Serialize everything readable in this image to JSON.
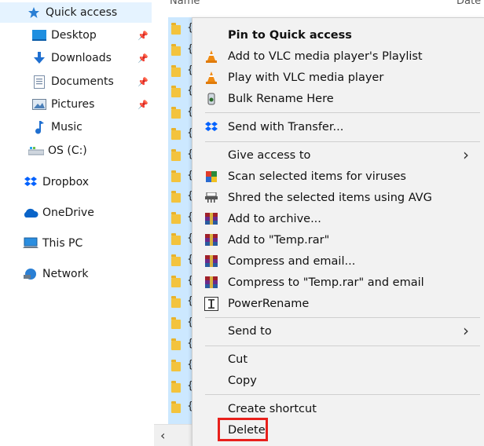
{
  "nav": {
    "items": [
      {
        "label": "Quick access",
        "icon": "star-icon",
        "pinned": false,
        "selected": true
      },
      {
        "label": "Desktop",
        "icon": "desktop-icon",
        "pinned": true
      },
      {
        "label": "Downloads",
        "icon": "download-arrow-icon",
        "pinned": true
      },
      {
        "label": "Documents",
        "icon": "documents-icon",
        "pinned": true
      },
      {
        "label": "Pictures",
        "icon": "pictures-icon",
        "pinned": true
      },
      {
        "label": "Music",
        "icon": "music-note-icon",
        "pinned": false
      },
      {
        "label": "OS (C:)",
        "icon": "drive-icon",
        "pinned": false
      },
      {
        "label": "Dropbox",
        "icon": "dropbox-icon",
        "pinned": false
      },
      {
        "label": "OneDrive",
        "icon": "onedrive-cloud-icon",
        "pinned": false
      },
      {
        "label": "This PC",
        "icon": "computer-icon",
        "pinned": false
      },
      {
        "label": "Network",
        "icon": "network-icon",
        "pinned": false
      }
    ]
  },
  "list": {
    "columns": [
      "Name",
      "Date"
    ],
    "row_glyph": "{"
  },
  "menu": {
    "items": [
      {
        "label": "Pin to Quick access",
        "icon": "",
        "bold": true
      },
      {
        "label": "Add to VLC media player's Playlist",
        "icon": "vlc-cone-icon"
      },
      {
        "label": "Play with VLC media player",
        "icon": "vlc-cone-icon"
      },
      {
        "label": "Bulk Rename Here",
        "icon": "bulk-rename-icon"
      },
      {
        "label": "Send with Transfer...",
        "icon": "dropbox-icon"
      },
      {
        "label": "Give access to",
        "icon": "",
        "submenu": true
      },
      {
        "label": "Scan selected items for viruses",
        "icon": "avg-scan-icon"
      },
      {
        "label": "Shred the selected items using AVG",
        "icon": "shredder-icon"
      },
      {
        "label": "Add to archive...",
        "icon": "winrar-icon"
      },
      {
        "label": "Add to \"Temp.rar\"",
        "icon": "winrar-icon"
      },
      {
        "label": "Compress and email...",
        "icon": "winrar-icon"
      },
      {
        "label": "Compress to \"Temp.rar\" and email",
        "icon": "winrar-icon"
      },
      {
        "label": "PowerRename",
        "icon": "powerrename-icon"
      },
      {
        "label": "Send to",
        "icon": "",
        "submenu": true
      },
      {
        "label": "Cut",
        "icon": ""
      },
      {
        "label": "Copy",
        "icon": ""
      },
      {
        "label": "Create shortcut",
        "icon": ""
      },
      {
        "label": "Delete",
        "icon": "",
        "highlighted": true
      }
    ],
    "submenu_arrow": "›",
    "highlight_color": "#e8201c"
  },
  "scroll": {
    "left_arrow": "‹"
  }
}
